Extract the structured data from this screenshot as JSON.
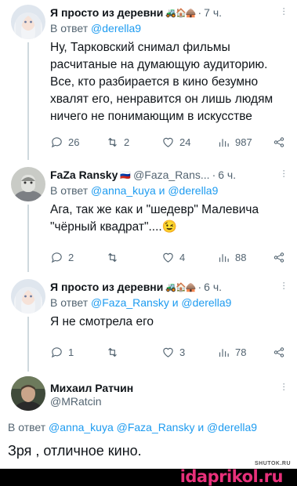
{
  "tweets": [
    {
      "name": "Я просто из деревни",
      "name_emoji": "🚜🏠🛖",
      "time": "7 ч.",
      "reply_prefix": "В ответ",
      "reply_to": "@derella9",
      "body": "Ну, Тарковский снимал фильмы расчитаные на думающую аудиторию. Все, кто разбирается в кино безумно хвалят его, ненравится он лишь людям ничего не понимающим в искусстве",
      "replies": "26",
      "retweets": "2",
      "likes": "24",
      "views": "987"
    },
    {
      "name": "FaZa Ransky",
      "name_emoji": "🇷🇺",
      "handle": "@Faza_Rans...",
      "time": "6 ч.",
      "reply_prefix": "В ответ",
      "reply_to": "@anna_kuya и @derella9",
      "body": "Ага, так же как и \"шедевр\" Малевича \"чёрный квадрат\"....😉",
      "replies": "2",
      "retweets": "",
      "likes": "4",
      "views": "88"
    },
    {
      "name": "Я просто из деревни",
      "name_emoji": "🚜🏠🛖",
      "time": "6 ч.",
      "reply_prefix": "В ответ",
      "reply_to": "@Faza_Ransky и @derella9",
      "body": "Я не смотрела его",
      "replies": "1",
      "retweets": "",
      "likes": "3",
      "views": "78"
    }
  ],
  "main_tweet": {
    "name": "Михаил Ратчин",
    "handle": "@MRatcin",
    "reply_prefix": "В ответ",
    "reply_to": "@anna_kuya @Faza_Ransky и @derella9",
    "body": "Зря , отличное кино."
  },
  "watermarks": {
    "small": "SHUTOK.RU",
    "large": "idaprikol.ru"
  },
  "colors": {
    "link": "#1d9bf0",
    "muted": "#536471",
    "watermark": "#e8307a"
  }
}
